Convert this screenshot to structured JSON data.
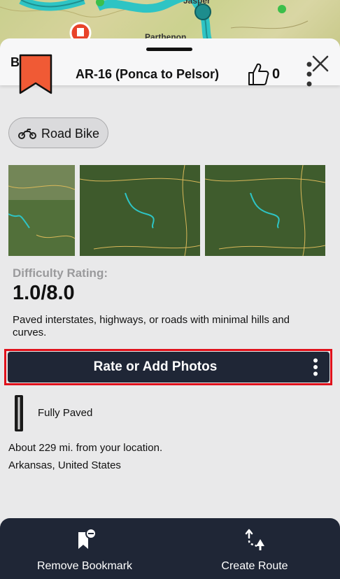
{
  "map": {
    "town_labels": [
      "Jasper",
      "Parthenon"
    ],
    "route_color": "#2ec4c4",
    "marker_color": "#e8432a"
  },
  "header": {
    "back_label": "Back",
    "close_icon": "close-icon"
  },
  "route": {
    "title": "AR-16 (Ponca to Pelsor)",
    "bookmark_color": "#f05a35",
    "likes": "0",
    "tag": "Road Bike"
  },
  "difficulty": {
    "label": "Difficulty Rating:",
    "value": "1.0/8.0",
    "description": "Paved interstates, highways, or roads with minimal hills and curves."
  },
  "action": {
    "label": "Rate or Add Photos",
    "highlight_color": "#e0111b",
    "bar_color": "#1f2636"
  },
  "surface": {
    "label": "Fully Paved"
  },
  "info": {
    "distance": "About 229 mi. from your location.",
    "location": "Arkansas, United States"
  },
  "bottom_bar": {
    "remove_bookmark_label": "Remove Bookmark",
    "create_route_label": "Create Route"
  }
}
